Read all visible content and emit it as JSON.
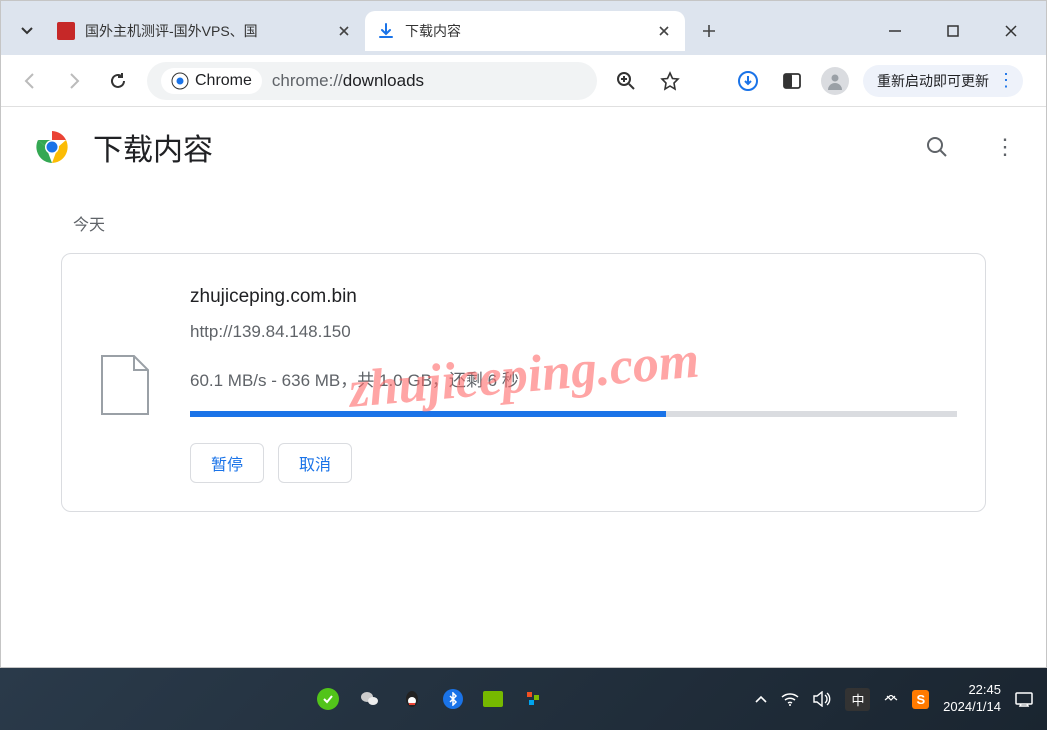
{
  "tabs": {
    "inactive": {
      "title": "国外主机测评-国外VPS、国"
    },
    "active": {
      "title": "下载内容"
    }
  },
  "toolbar": {
    "chrome_label": "Chrome",
    "url_scheme": "chrome://",
    "url_path": "downloads",
    "restart_update": "重新启动即可更新"
  },
  "downloads": {
    "page_title": "下载内容",
    "date_label": "今天",
    "item": {
      "filename": "zhujiceping.com.bin",
      "source_url": "http://139.84.148.150",
      "speed": "60.1 MB/s",
      "downloaded": "636 MB",
      "total": "1.0 GB",
      "remaining_label": "还剩",
      "remaining_time": "6 秒",
      "total_label": "共",
      "progress_pct": 62,
      "pause_label": "暂停",
      "cancel_label": "取消"
    }
  },
  "watermark": "zhujiceping.com",
  "taskbar": {
    "time": "22:45",
    "date": "2024/1/14",
    "ime": "中",
    "sogou": "S"
  },
  "icons": {
    "down_caret": "down-caret-icon",
    "favicon1": "site-favicon",
    "download_badge": "download-icon",
    "close": "close-icon",
    "plus": "plus-icon",
    "minimize": "minimize-icon",
    "maximize": "maximize-icon",
    "win_close": "close-icon",
    "back": "back-icon",
    "forward": "forward-icon",
    "reload": "reload-icon",
    "chrome": "chrome-icon",
    "zoom": "zoom-icon",
    "star": "star-icon",
    "dl_circle": "download-circle-icon",
    "panel": "side-panel-icon",
    "avatar": "avatar-icon",
    "menu": "more-vert-icon",
    "search": "search-icon",
    "file": "file-icon"
  }
}
